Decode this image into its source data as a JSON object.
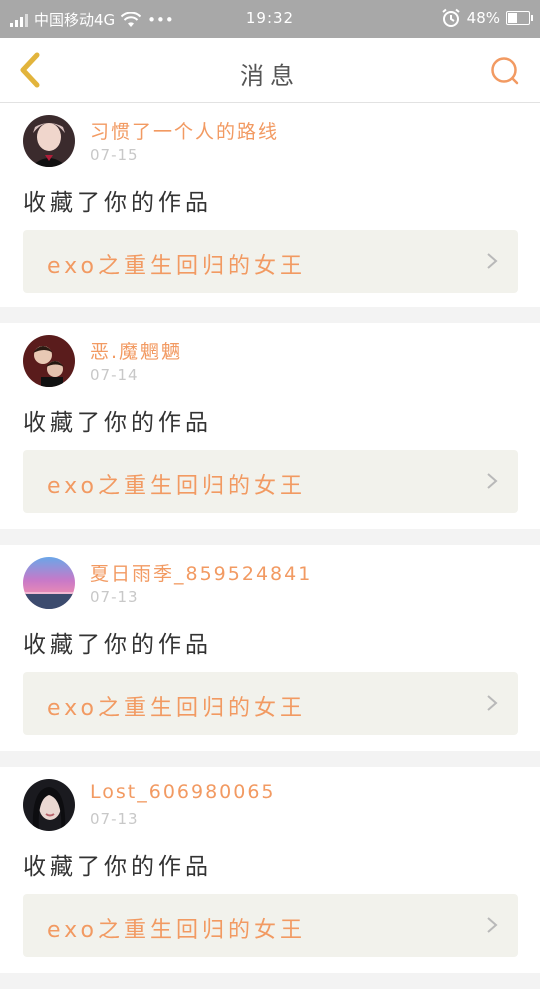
{
  "status_bar": {
    "carrier": "中国移动4G",
    "dots": "•••",
    "time": "19:32",
    "battery": "48%",
    "battery_level": 0.48,
    "icons": [
      "signal-icon",
      "wifi-icon",
      "alarm-icon",
      "battery-icon"
    ]
  },
  "header": {
    "title": "消息",
    "back_icon": "chevron-left-icon",
    "search_icon": "search-icon",
    "accent_color": "#f29a62",
    "back_color": "#e2b43c"
  },
  "messages": [
    {
      "username": "习惯了一个人的路线",
      "date": "07-15",
      "action": "收藏了你的作品",
      "work_title": "exo之重生回归的女王"
    },
    {
      "username": "恶.魔魍魉",
      "date": "07-14",
      "action": "收藏了你的作品",
      "work_title": "exo之重生回归的女王"
    },
    {
      "username": "夏日雨季_859524841",
      "date": "07-13",
      "action": "收藏了你的作品",
      "work_title": "exo之重生回归的女王"
    },
    {
      "username": "Lost_606980065",
      "date": "07-13",
      "action": "收藏了你的作品",
      "work_title": "exo之重生回归的女王"
    }
  ]
}
